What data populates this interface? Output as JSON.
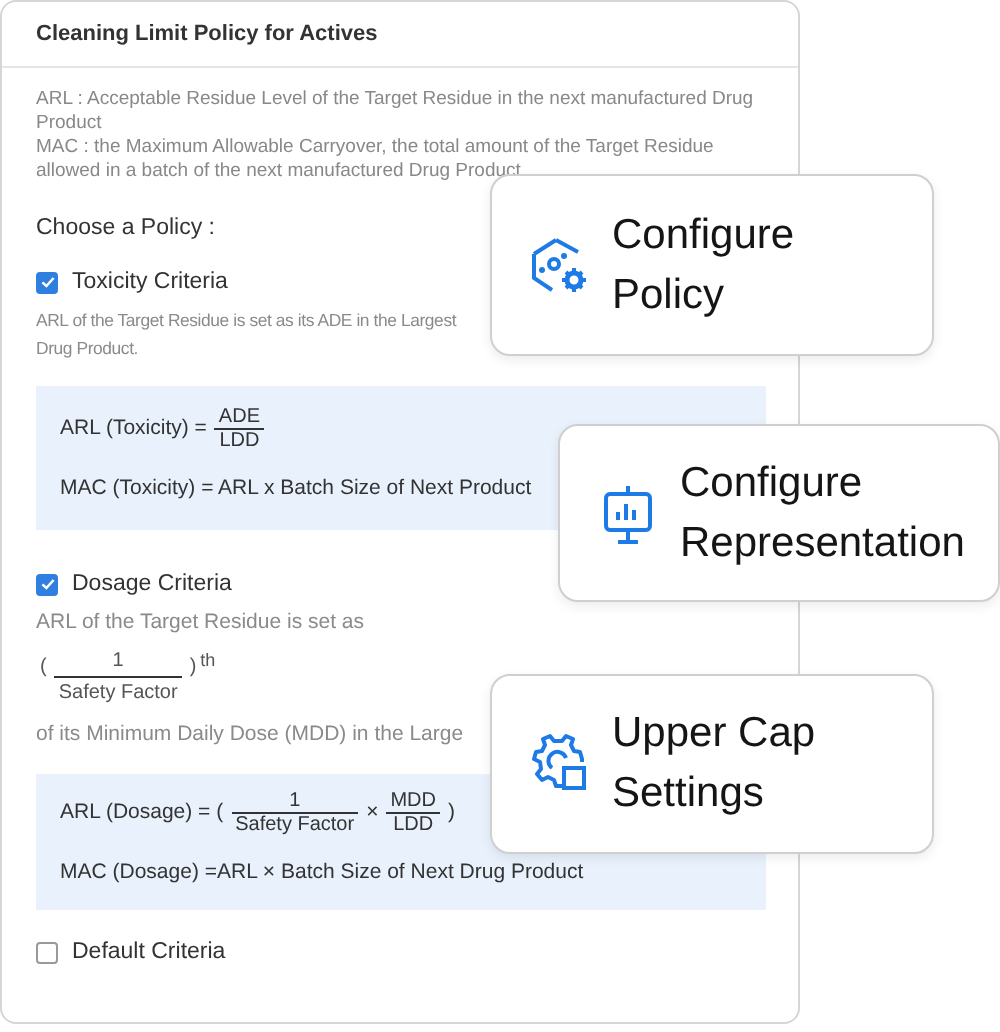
{
  "panel": {
    "title": "Cleaning Limit Policy for Actives",
    "definitions": [
      "ARL :  Acceptable Residue Level of the Target Residue in the next manufactured Drug Product",
      "MAC : the Maximum Allowable Carryover, the total amount of the Target Residue allowed in a batch of the next manufactured Drug Product"
    ],
    "choose_label": "Choose a Policy :",
    "policies": [
      {
        "label": "Toxicity Criteria",
        "checked": true,
        "details": [
          {
            "kind": "text",
            "text": "ARL of the Target Residue is set as its ADE in the Largest"
          },
          {
            "kind": "text",
            "text": "Drug Product."
          }
        ],
        "box": [
          [
            {
              "kind": "text",
              "text": "ARL (Toxicity) ="
            },
            {
              "kind": "frac",
              "num": "ADE",
              "den": "LDD"
            }
          ],
          [
            {
              "kind": "text",
              "text": "MAC (Toxicity) = ARL x Batch Size of Next Product"
            }
          ]
        ]
      },
      {
        "label": "Dosage Criteria",
        "checked": true,
        "details": [
          {
            "kind": "text",
            "text": "ARL of the Target Residue is set as"
          },
          {
            "kind": "formula",
            "parts": [
              {
                "kind": "text",
                "text": "("
              },
              {
                "kind": "frac",
                "num": "1",
                "den": "Safety Factor"
              },
              {
                "kind": "text",
                "text": ")"
              },
              {
                "kind": "sup",
                "text": "th"
              }
            ]
          },
          {
            "kind": "text",
            "text": "of its Minimum Daily Dose (MDD) in the Large"
          }
        ],
        "box": [
          [
            {
              "kind": "text",
              "text": "ARL (Dosage) = ("
            },
            {
              "kind": "frac",
              "num": "1",
              "den": "Safety Factor"
            },
            {
              "kind": "text",
              "text": "×"
            },
            {
              "kind": "frac",
              "num": "MDD",
              "den": "LDD"
            },
            {
              "kind": "text",
              "text": ")"
            }
          ],
          [
            {
              "kind": "text",
              "text": "MAC (Dosage) =ARL × Batch Size of Next Drug Product"
            }
          ]
        ]
      },
      {
        "label": "Default Criteria",
        "checked": false
      }
    ]
  },
  "cards": [
    {
      "lines": [
        "Configure",
        "Policy"
      ]
    },
    {
      "lines": [
        "Configure",
        "Representation"
      ]
    },
    {
      "lines": [
        "Upper Cap",
        "Settings"
      ]
    }
  ]
}
